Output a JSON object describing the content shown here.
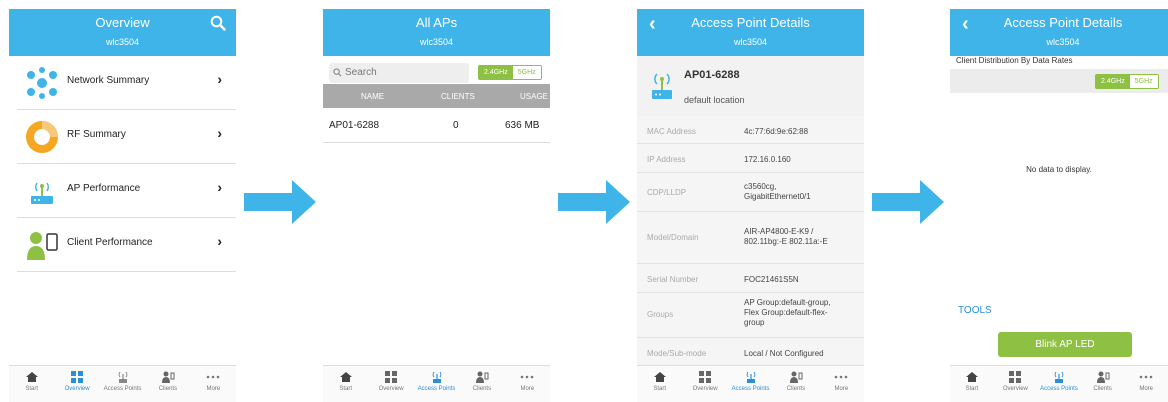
{
  "colors": {
    "header": "#3fb4e8",
    "accent_green": "#8dc043",
    "arrow": "#3fb4e8",
    "tab_active": "#2a8fd8"
  },
  "tabbar": {
    "items": [
      "Start",
      "Overview",
      "Access Points",
      "Clients",
      "More"
    ]
  },
  "overview": {
    "title": "Overview",
    "subtitle": "wlc3504",
    "menu": [
      {
        "label": "Network Summary",
        "icon": "network-summary-icon"
      },
      {
        "label": "RF Summary",
        "icon": "rf-summary-icon"
      },
      {
        "label": "AP Performance",
        "icon": "ap-performance-icon"
      },
      {
        "label": "Client Performance",
        "icon": "client-performance-icon"
      }
    ],
    "active_tab": "Overview"
  },
  "all_aps": {
    "title": "All APs",
    "subtitle": "wlc3504",
    "search_placeholder": "Search",
    "band_24": "2.4GHz",
    "band_5": "5GHz",
    "columns": [
      "NAME",
      "CLIENTS",
      "USAGE"
    ],
    "rows": [
      {
        "name": "AP01-6288",
        "clients": "0",
        "usage": "636 MB"
      }
    ],
    "active_tab": "Access Points"
  },
  "details": {
    "title": "Access Point Details",
    "subtitle": "wlc3504",
    "ap_name": "AP01-6288",
    "ap_location": "default location",
    "fields": [
      {
        "k": "MAC Address",
        "v": "4c:77:6d:9e:62:88"
      },
      {
        "k": "IP Address",
        "v": "172.16.0.160"
      },
      {
        "k": "CDP/LLDP",
        "v": "c3560cg,\nGigabitEthernet0/1"
      },
      {
        "k": "Model/Domain",
        "v": "AIR-AP4800-E-K9 /\n802.11bg:-E   802.11a:-E"
      },
      {
        "k": "Serial Number",
        "v": "FOC21461S5N"
      },
      {
        "k": "Groups",
        "v": "AP Group:default-group,\nFlex Group:default-flex-\ngroup"
      },
      {
        "k": "Mode/Sub-mode",
        "v": "Local / Not Configured"
      }
    ],
    "active_tab": "Access Points"
  },
  "distribution": {
    "title": "Access Point Details",
    "subtitle": "wlc3504",
    "section_title": "Client Distribution By Data Rates",
    "band_24": "2.4GHz",
    "band_5": "5GHz",
    "no_data": "No data to display.",
    "tools_label": "TOOLS",
    "blink_button": "Blink AP LED",
    "active_tab": "Access Points"
  }
}
